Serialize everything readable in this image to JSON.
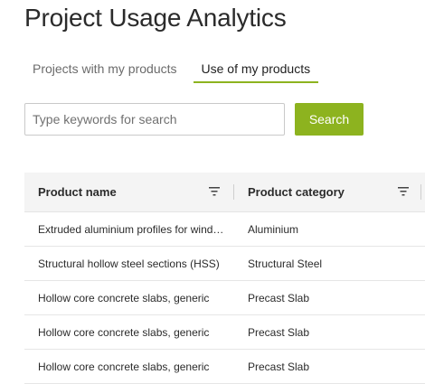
{
  "page": {
    "title": "Project Usage Analytics"
  },
  "tabs": [
    {
      "label": "Projects with my products",
      "active": false
    },
    {
      "label": "Use of my products",
      "active": true
    }
  ],
  "search": {
    "placeholder": "Type keywords for search",
    "value": "",
    "button_label": "Search"
  },
  "table": {
    "columns": [
      {
        "label": "Product name",
        "icon": "filter-icon"
      },
      {
        "label": "Product category",
        "icon": "filter-icon"
      }
    ],
    "rows": [
      {
        "name": "Extruded aluminium profiles for windows and doors",
        "category": "Aluminium"
      },
      {
        "name": "Structural hollow steel sections (HSS)",
        "category": "Structural Steel"
      },
      {
        "name": "Hollow core concrete slabs, generic",
        "category": "Precast Slab"
      },
      {
        "name": "Hollow core concrete slabs, generic",
        "category": "Precast Slab"
      },
      {
        "name": "Hollow core concrete slabs, generic",
        "category": "Precast Slab"
      }
    ]
  },
  "colors": {
    "accent": "#8db31f",
    "header_bg": "#f4f4f4",
    "text": "#2b2b2b"
  }
}
